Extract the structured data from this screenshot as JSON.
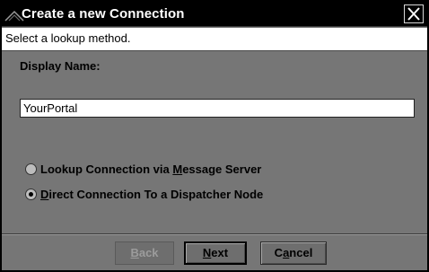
{
  "window": {
    "title": "Create a new Connection",
    "close_icon": "close-x-icon"
  },
  "info": {
    "text": "Select a lookup method."
  },
  "form": {
    "display_name_label": "Display Name:",
    "display_name_value": "YourPortal"
  },
  "options": [
    {
      "label": "Lookup Connection via Message Server",
      "selected": false
    },
    {
      "label": "Direct Connection To a Dispatcher Node",
      "selected": true
    }
  ],
  "buttons": {
    "back": {
      "pre": "",
      "mnemonic": "B",
      "post": "ack",
      "enabled": false
    },
    "next": {
      "pre": "",
      "mnemonic": "N",
      "post": "ext",
      "enabled": true
    },
    "cancel": {
      "pre": "C",
      "mnemonic": "a",
      "post": "ncel",
      "enabled": true
    }
  },
  "colors": {
    "titlebar": "#000000",
    "dialog_bg": "#767676",
    "info_bg": "#ffffff",
    "disabled_text": "#9c9c9c"
  }
}
